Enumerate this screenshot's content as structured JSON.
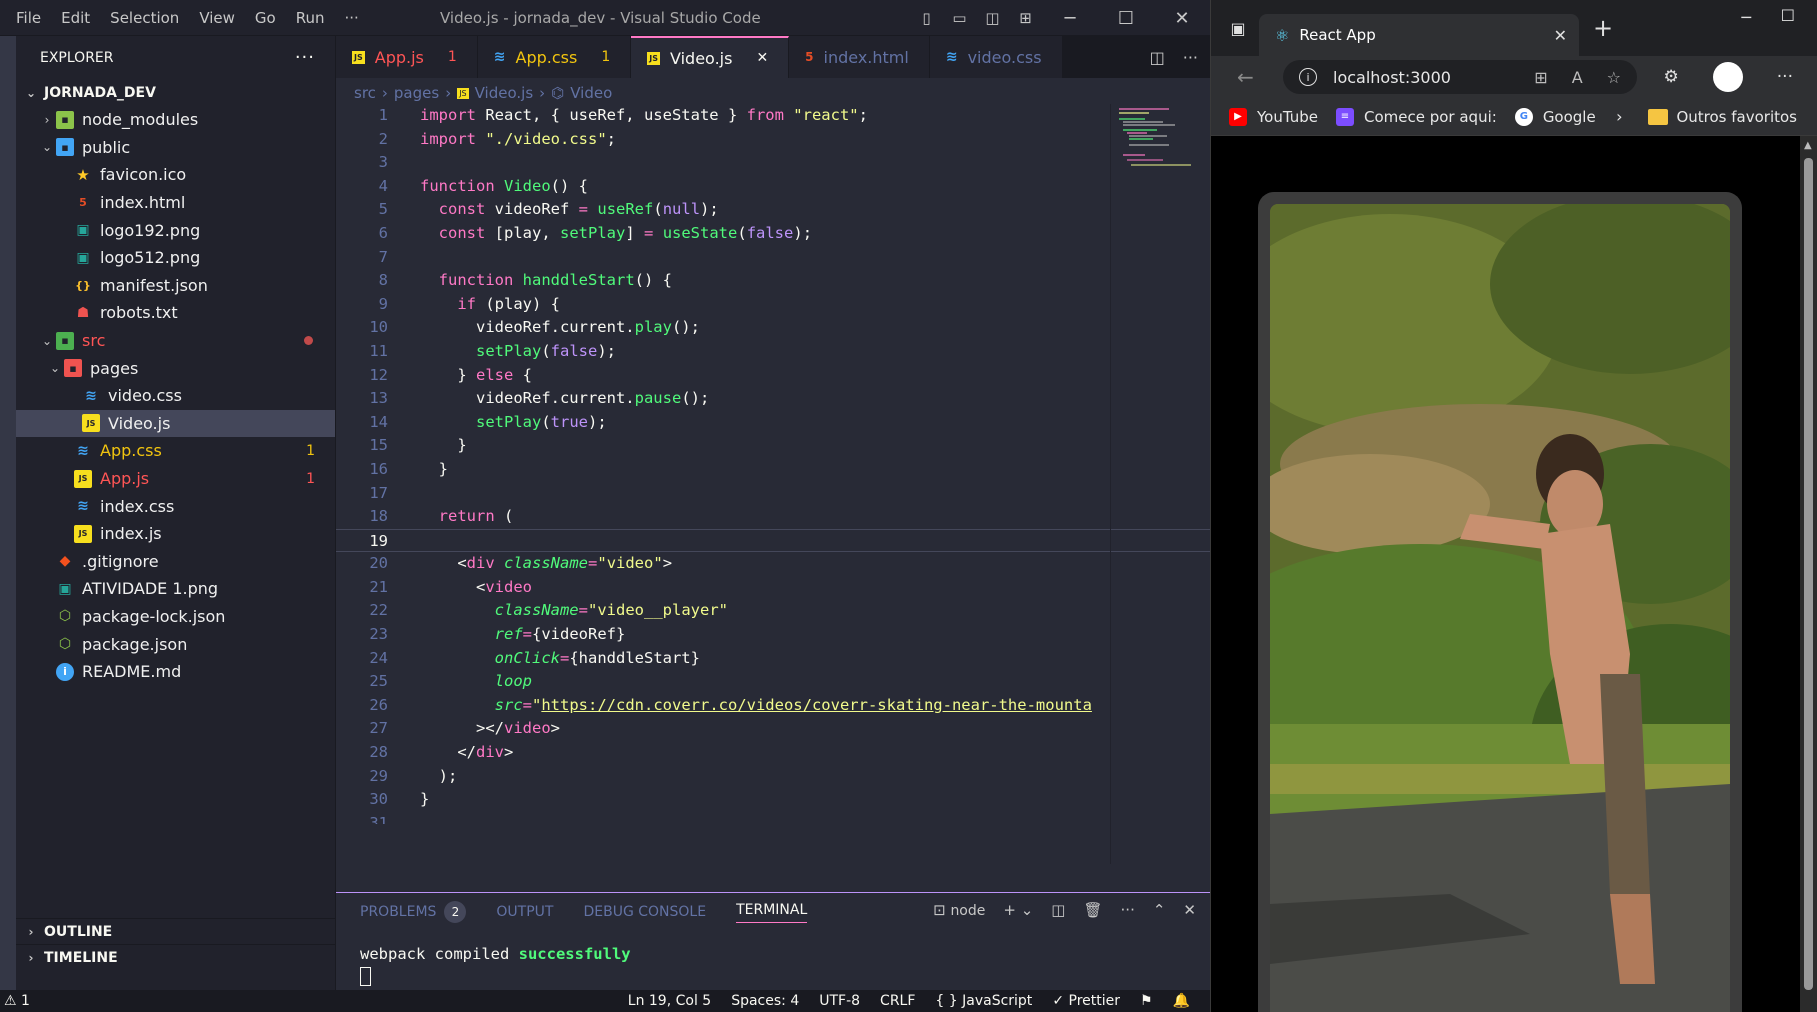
{
  "vscode": {
    "menu": [
      "File",
      "Edit",
      "Selection",
      "View",
      "Go",
      "Run",
      "···"
    ],
    "window_title": "Video.js - jornada_dev - Visual Studio Code",
    "explorer_title": "EXPLORER",
    "explorer_more": "···",
    "project": "JORNADA_DEV",
    "tree": [
      {
        "label": "node_modules",
        "icon": "folder-node-icon"
      },
      {
        "label": "public",
        "icon": "folder-public-icon"
      },
      {
        "label": "favicon.ico",
        "icon": "star-icon"
      },
      {
        "label": "index.html",
        "icon": "html-icon"
      },
      {
        "label": "logo192.png",
        "icon": "image-icon"
      },
      {
        "label": "logo512.png",
        "icon": "image-icon"
      },
      {
        "label": "manifest.json",
        "icon": "json-icon"
      },
      {
        "label": "robots.txt",
        "icon": "robot-icon"
      },
      {
        "label": "src",
        "icon": "folder-src-icon"
      },
      {
        "label": "pages",
        "icon": "folder-pages-icon"
      },
      {
        "label": "video.css",
        "icon": "css-icon"
      },
      {
        "label": "Video.js",
        "icon": "js-icon"
      },
      {
        "label": "App.css",
        "icon": "css-icon",
        "badge": "1"
      },
      {
        "label": "App.js",
        "icon": "js-icon",
        "badge": "1"
      },
      {
        "label": "index.css",
        "icon": "css-icon"
      },
      {
        "label": "index.js",
        "icon": "js-icon"
      },
      {
        "label": ".gitignore",
        "icon": "git-icon"
      },
      {
        "label": "ATIVIDADE 1.png",
        "icon": "image-icon"
      },
      {
        "label": "package-lock.json",
        "icon": "node-icon"
      },
      {
        "label": "package.json",
        "icon": "node-icon"
      },
      {
        "label": "README.md",
        "icon": "info-icon"
      }
    ],
    "outline": "OUTLINE",
    "timeline": "TIMELINE",
    "tabs": [
      {
        "label": "App.js",
        "marker": "1",
        "state": "error"
      },
      {
        "label": "App.css",
        "marker": "1",
        "state": "error"
      },
      {
        "label": "Video.js",
        "marker": "✕",
        "state": "active"
      },
      {
        "label": "index.html",
        "marker": "",
        "state": "normal"
      },
      {
        "label": "video.css",
        "marker": "",
        "state": "normal"
      }
    ],
    "breadcrumb": [
      "src",
      "pages",
      "Video.js",
      "Video"
    ],
    "panel_tabs": {
      "problems": "PROBLEMS",
      "problems_count": "2",
      "output": "OUTPUT",
      "debug": "DEBUG CONSOLE",
      "terminal": "TERMINAL"
    },
    "terminal_shell": "node",
    "terminal_text": "webpack compiled ",
    "terminal_ok": "successfully",
    "status": {
      "problems": "⚠ 1",
      "position": "Ln 19, Col 5",
      "spaces": "Spaces: 4",
      "encoding": "UTF-8",
      "eol": "CRLF",
      "language": "{ } JavaScript",
      "formatter": "✓ Prettier"
    }
  },
  "browser": {
    "tab_title": "React App",
    "url": "localhost:3000",
    "bookmarks": [
      "YouTube",
      "Comece por aqui:",
      "Google"
    ],
    "other_favorites": "Outros favoritos"
  },
  "colors": {
    "accent": "#ff79c6",
    "vscode_bg": "#282a36",
    "sidebar_bg": "#21222c",
    "browser_bg": "#202124"
  }
}
